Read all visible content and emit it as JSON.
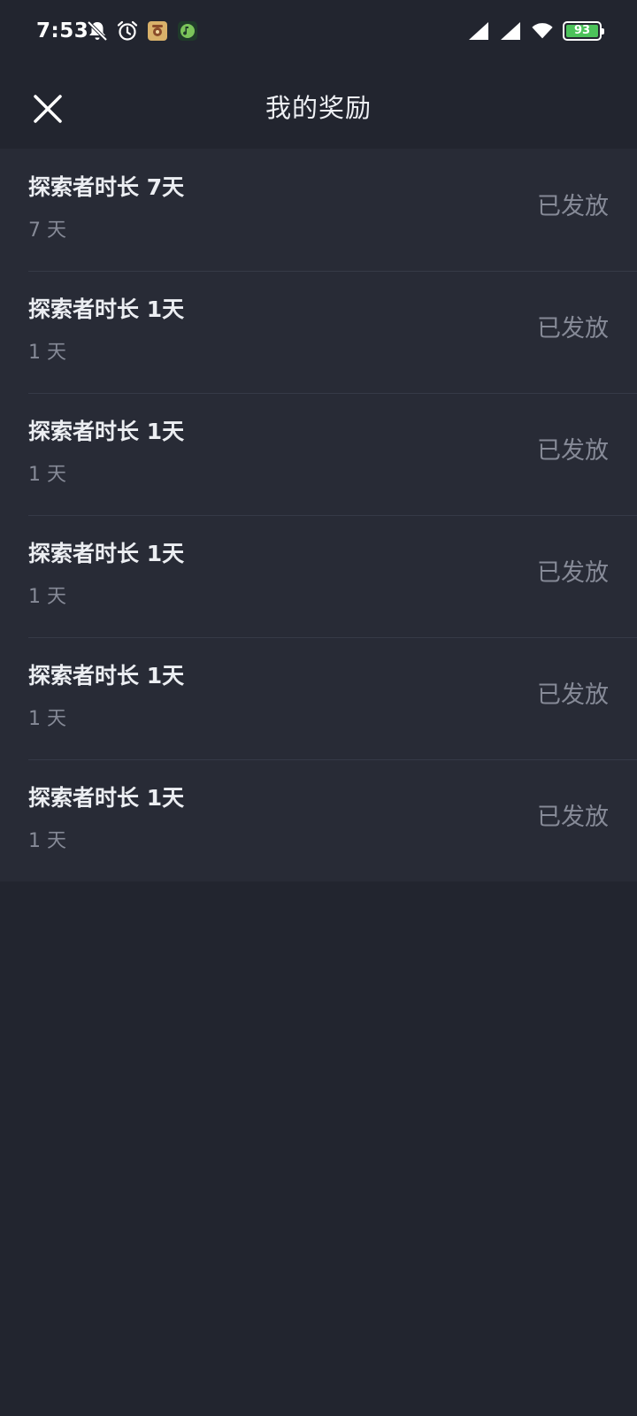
{
  "status_bar": {
    "time": "7:53",
    "left_icons": [
      "bell-off-icon",
      "alarm-icon",
      "app-notification-icon",
      "music-app-icon"
    ],
    "right_icons": [
      "signal-icon",
      "signal-icon",
      "wifi-icon"
    ],
    "battery": "93",
    "battery_color": "#4cc25a"
  },
  "header": {
    "title": "我的奖励",
    "close_icon": "close-icon"
  },
  "rewards": [
    {
      "name": "探索者时长 7天",
      "detail": "7 天",
      "status": "已发放"
    },
    {
      "name": "探索者时长 1天",
      "detail": "1 天",
      "status": "已发放"
    },
    {
      "name": "探索者时长 1天",
      "detail": "1 天",
      "status": "已发放"
    },
    {
      "name": "探索者时长 1天",
      "detail": "1 天",
      "status": "已发放"
    },
    {
      "name": "探索者时长 1天",
      "detail": "1 天",
      "status": "已发放"
    },
    {
      "name": "探索者时长 1天",
      "detail": "1 天",
      "status": "已发放"
    }
  ],
  "colors": {
    "background": "#22252f",
    "card": "#282b36",
    "text_primary": "#eceef2",
    "text_secondary": "#868a97"
  }
}
